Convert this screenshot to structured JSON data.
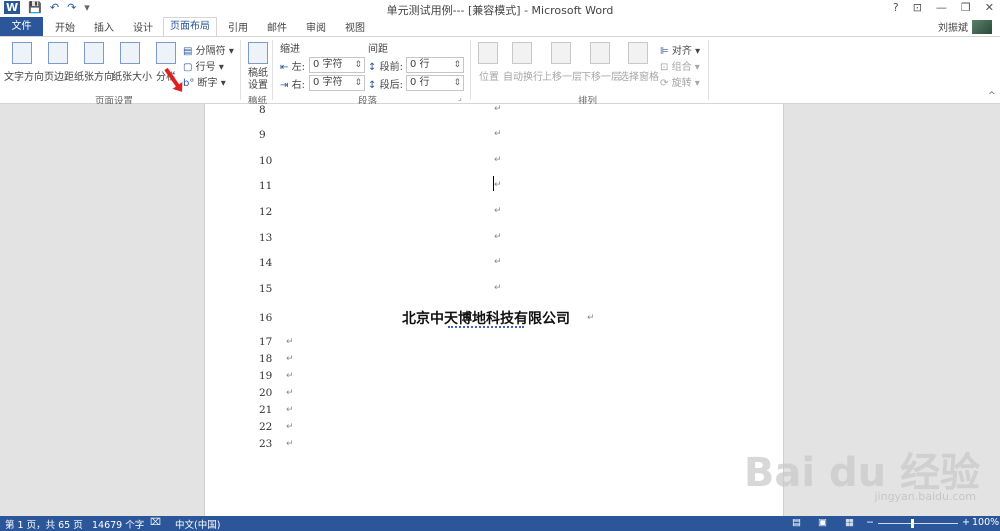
{
  "titlebar": {
    "title": "单元测试用例--- [兼容模式] - Microsoft Word",
    "qat": [
      "W",
      "💾",
      "↶",
      "↷",
      "▾"
    ],
    "controls": [
      "?",
      "⊡",
      "—",
      "❐",
      "✕"
    ]
  },
  "tabs": {
    "file": "文件",
    "items": [
      "开始",
      "插入",
      "设计",
      "页面布局",
      "引用",
      "邮件",
      "审阅",
      "视图"
    ],
    "user": "刘振斌"
  },
  "ribbon": {
    "page_setup": {
      "text_direction": "文字方向",
      "margins": "页边距",
      "orientation": "纸张方向",
      "size": "纸张大小",
      "columns": "分栏",
      "breaks": "分隔符",
      "line_numbers": "行号",
      "hyphenation": "断字",
      "label": "页面设置"
    },
    "draft": {
      "button": "稿纸设置",
      "label": "稿纸"
    },
    "paragraph": {
      "indent": "缩进",
      "spacing": "间距",
      "left_label": "左:",
      "right_label": "右:",
      "before_label": "段前:",
      "after_label": "段后:",
      "left_value": "0 字符",
      "right_value": "0 字符",
      "before_value": "0 行",
      "after_value": "0 行",
      "label": "段落"
    },
    "arrange": {
      "position": "位置",
      "wrap": "自动换行",
      "forward": "上移一层",
      "backward": "下移一层",
      "selection_pane": "选择窗格",
      "align": "对齐",
      "group": "组合",
      "rotate": "旋转",
      "label": "排列"
    }
  },
  "document": {
    "line_numbers": [
      "8",
      "9",
      "10",
      "11",
      "12",
      "13",
      "14",
      "15",
      "16",
      "17",
      "18",
      "19",
      "20",
      "21",
      "22",
      "23"
    ],
    "paragraph_mark": "↵",
    "company": "北京中天博地科技有限公司"
  },
  "watermark": {
    "main": "Bai du 经验",
    "sub": "jingyan.baidu.com"
  },
  "status": {
    "page": "第 1 页，共 65 页",
    "words": "14679 个字",
    "language": "中文(中国)",
    "zoom": "100%"
  }
}
